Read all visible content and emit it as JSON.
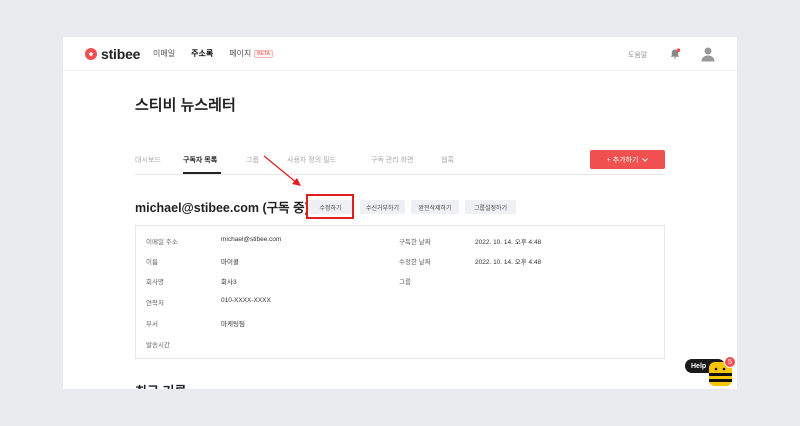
{
  "nav": {
    "logo": "stibee",
    "items": [
      "이메일",
      "주소록",
      "페이지"
    ],
    "beta": "BETA",
    "help": "도움말"
  },
  "page": {
    "title": "스티비 뉴스레터",
    "tabs": [
      "대시보드",
      "구독자 목록",
      "그룹",
      "사용자 정의 필드",
      "구독 관리 화면",
      "웹훅"
    ],
    "active_tab": "구독자 목록",
    "add_button": "+ 추가하기"
  },
  "subscriber": {
    "heading": "michael@stibee.com (구독 중)",
    "actions": [
      "수정하기",
      "수신거부하기",
      "완전삭제하기",
      "그룹설정하기"
    ],
    "fields_left": [
      {
        "label": "이메일 주소",
        "value": "michael@stibee.com"
      },
      {
        "label": "이름",
        "value": "마이콜"
      },
      {
        "label": "회사명",
        "value": "회사3"
      },
      {
        "label": "연락처",
        "value": "010-XXXX-XXXX"
      },
      {
        "label": "부서",
        "value": "마케팅팀"
      },
      {
        "label": "발송시간",
        "value": ""
      }
    ],
    "fields_right": [
      {
        "label": "구독한 날짜",
        "value": "2022. 10. 14. 오후 4:48"
      },
      {
        "label": "수정한 날짜",
        "value": "2022. 10. 14. 오후 4:48"
      },
      {
        "label": "그룹",
        "value": ""
      }
    ]
  },
  "next_section": "최근 기록",
  "help_widget": {
    "label": "Help",
    "count": "5"
  },
  "colors": {
    "accent": "#f0504f",
    "highlight": "#e0201d"
  }
}
